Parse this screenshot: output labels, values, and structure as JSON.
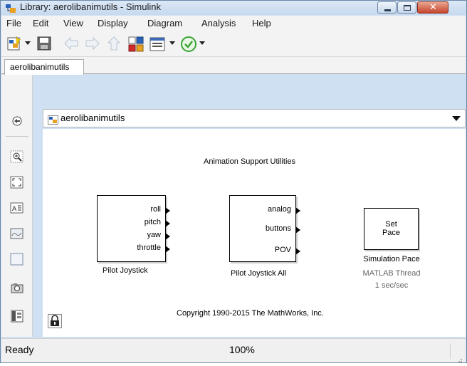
{
  "window": {
    "title": "Library: aerolibanimutils - Simulink"
  },
  "menu": {
    "items": [
      "File",
      "Edit",
      "View",
      "Display",
      "Diagram",
      "Analysis",
      "Help"
    ]
  },
  "toolbar": {
    "buttons": [
      "new-model-icon",
      "save-icon",
      "back-arrow-icon",
      "forward-arrow-icon",
      "up-arrow-icon",
      "library-browser-icon",
      "model-config-icon",
      "check-icon"
    ]
  },
  "tabs": [
    {
      "label": "aerolibanimutils"
    }
  ],
  "address": {
    "path": "aerolibanimutils"
  },
  "palette": {
    "tools": [
      "hide-explorer-icon",
      "zoom-icon",
      "fit-view-icon",
      "annotation-icon",
      "image-icon",
      "area-icon",
      "screenshot-icon",
      "model-browser-icon"
    ]
  },
  "canvas": {
    "title": "Animation Support Utilities",
    "copyright": "Copyright 1990-2015 The MathWorks, Inc.",
    "blocks": {
      "pilot_joystick": {
        "ports": [
          "roll",
          "pitch",
          "yaw",
          "throttle"
        ],
        "caption": "Pilot Joystick"
      },
      "pilot_joystick_all": {
        "ports": [
          "analog",
          "buttons",
          "POV"
        ],
        "caption": "Pilot Joystick All"
      },
      "simulation_pace": {
        "label_line1": "Set",
        "label_line2": "Pace",
        "caption": "Simulation Pace",
        "sub1": "MATLAB Thread",
        "sub2": "1 sec/sec"
      }
    }
  },
  "status": {
    "state": "Ready",
    "zoom": "100%"
  },
  "colors": {
    "title_bar": "#c6d9ee",
    "close_button": "#c6452c",
    "check_green": "#3aa335"
  }
}
